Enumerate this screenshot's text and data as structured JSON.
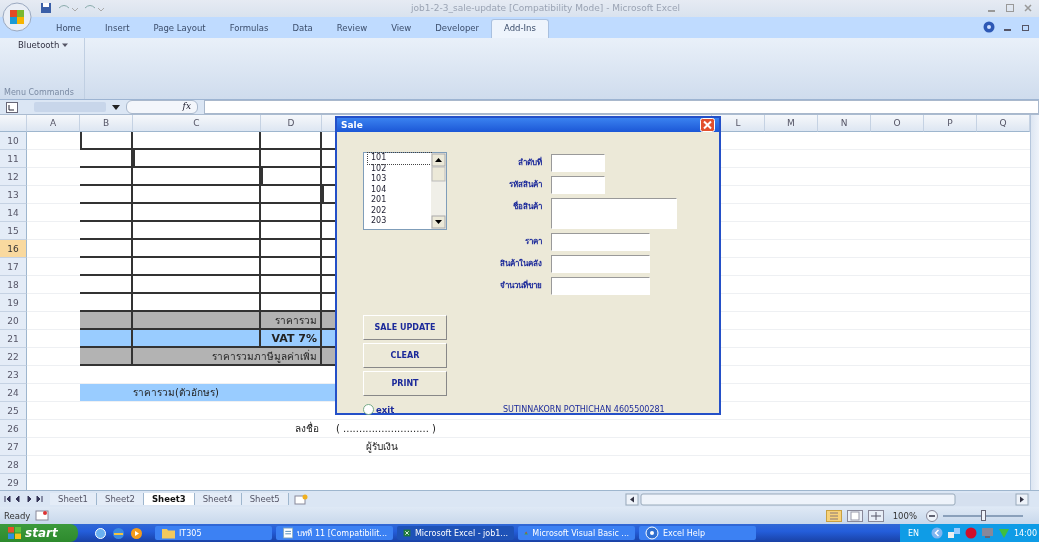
{
  "window": {
    "title": "job1-2-3_sale-update  [Compatibility Mode] - Microsoft Excel"
  },
  "ribbon": {
    "tabs": [
      {
        "label": "Home",
        "selected": false
      },
      {
        "label": "Insert",
        "selected": false
      },
      {
        "label": "Page Layout",
        "selected": false
      },
      {
        "label": "Formulas",
        "selected": false
      },
      {
        "label": "Data",
        "selected": false
      },
      {
        "label": "Review",
        "selected": false
      },
      {
        "label": "View",
        "selected": false
      },
      {
        "label": "Developer",
        "selected": false
      },
      {
        "label": "Add-Ins",
        "selected": true
      }
    ],
    "group": {
      "button": "Bluetooth",
      "caption": "Menu Commands"
    }
  },
  "formula_bar": {
    "fx": "fx"
  },
  "sheet": {
    "columns": [
      "A",
      "B",
      "C",
      "D",
      "L",
      "M",
      "N",
      "O",
      "P",
      "Q"
    ],
    "rows": [
      {
        "number": "10",
        "selected": false,
        "kind": "table"
      },
      {
        "number": "11",
        "selected": false,
        "kind": "table"
      },
      {
        "number": "12",
        "selected": false,
        "kind": "table"
      },
      {
        "number": "13",
        "selected": false,
        "kind": "table"
      },
      {
        "number": "14",
        "selected": false,
        "kind": "table"
      },
      {
        "number": "15",
        "selected": false,
        "kind": "table"
      },
      {
        "number": "16",
        "selected": true,
        "kind": "table"
      },
      {
        "number": "17",
        "selected": false,
        "kind": "table"
      },
      {
        "number": "18",
        "selected": false,
        "kind": "table"
      },
      {
        "number": "19",
        "selected": false,
        "kind": "table"
      },
      {
        "number": "20",
        "selected": false,
        "kind": "subtotal",
        "text": "ราคารวม"
      },
      {
        "number": "21",
        "selected": false,
        "kind": "vat",
        "text": "VAT 7%"
      },
      {
        "number": "22",
        "selected": false,
        "kind": "grand",
        "text": "ราคารวมภาษีมูลค่าเพิ่ม"
      },
      {
        "number": "23",
        "selected": false,
        "kind": "blank"
      },
      {
        "number": "24",
        "selected": false,
        "kind": "words",
        "text": "ราคารวม(ตัวอักษร)"
      },
      {
        "number": "25",
        "selected": false,
        "kind": "blank"
      },
      {
        "number": "26",
        "selected": false,
        "kind": "sign",
        "text": "ลงชื่อ",
        "text_2": "( ........................... )"
      },
      {
        "number": "27",
        "selected": false,
        "kind": "receiver",
        "text": "ผู้รับเงิน"
      },
      {
        "number": "28",
        "selected": false,
        "kind": "blank"
      },
      {
        "number": "29",
        "selected": false,
        "kind": "blank"
      }
    ]
  },
  "dialog": {
    "title": "Sale",
    "list": [
      {
        "label": "101",
        "selected": true
      },
      {
        "label": "102",
        "selected": false
      },
      {
        "label": "103",
        "selected": false
      },
      {
        "label": "104",
        "selected": false
      },
      {
        "label": "201",
        "selected": false
      },
      {
        "label": "202",
        "selected": false
      },
      {
        "label": "203",
        "selected": false
      }
    ],
    "fields": [
      {
        "label": "ลำดับที่",
        "kind": "short"
      },
      {
        "label": "รหัสสินค้า",
        "kind": "short"
      },
      {
        "label": "ชื่อสินค้า",
        "kind": "tall"
      },
      {
        "label": "ราคา",
        "kind": "medium"
      },
      {
        "label": "สินค้าในคลัง",
        "kind": "medium"
      },
      {
        "label": "จำนวนที่ขาย",
        "kind": "medium"
      }
    ],
    "buttons": [
      "SALE UPDATE",
      "CLEAR",
      "PRINT"
    ],
    "exit": {
      "label": "exit",
      "checked": false
    },
    "credit": "SUTINNAKORN POTHICHAN 4605500281"
  },
  "sheet_tabs": [
    {
      "label": "Sheet1",
      "selected": false
    },
    {
      "label": "Sheet2",
      "selected": false
    },
    {
      "label": "Sheet3",
      "selected": true
    },
    {
      "label": "Sheet4",
      "selected": false
    },
    {
      "label": "Sheet5",
      "selected": false
    }
  ],
  "status_bar": {
    "text": "Ready",
    "zoom": "100%",
    "zoom_slider": {
      "level": 0.5
    }
  },
  "taskbar": {
    "start": "start",
    "tasks": [
      {
        "label": "IT305",
        "kind": "folder",
        "selected": false
      },
      {
        "label": "บทที่ 11 [Compatibilit...",
        "kind": "document",
        "selected": false
      },
      {
        "label": "Microsoft Excel - job1...",
        "kind": "excel",
        "selected": true
      },
      {
        "label": "Microsoft Visual Basic ...",
        "kind": "vb",
        "selected": false
      },
      {
        "label": "Excel Help",
        "kind": "help",
        "selected": false
      }
    ],
    "language": "EN",
    "clock": "14:00"
  }
}
